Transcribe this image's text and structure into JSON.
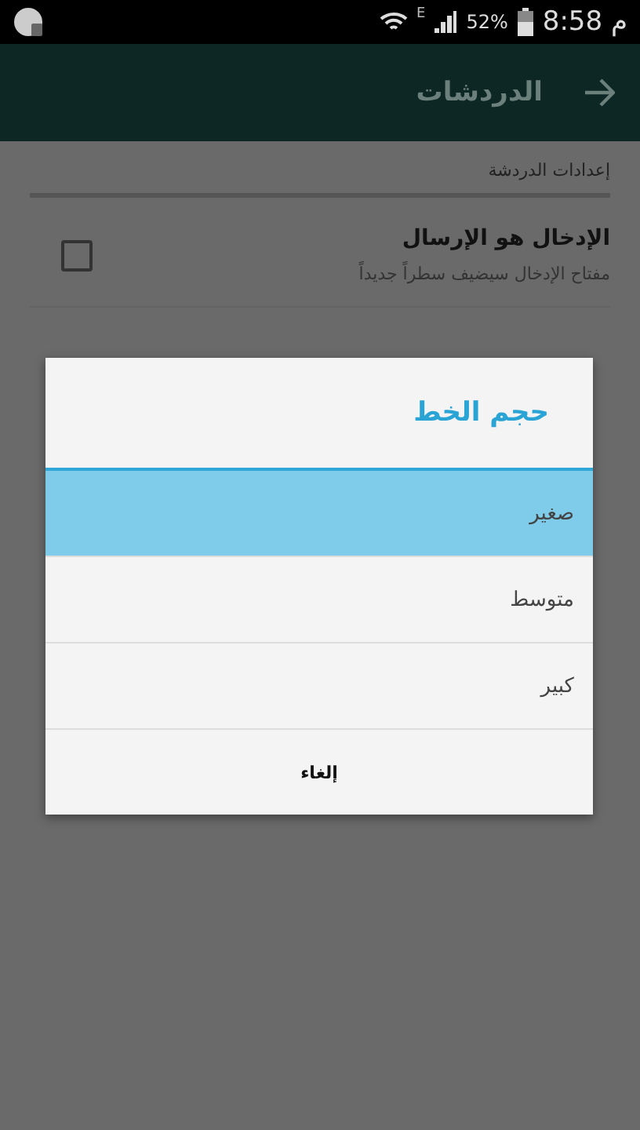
{
  "status_bar": {
    "network": "E",
    "battery": "52%",
    "time": "م 8:58"
  },
  "toolbar": {
    "title": "الدردشات"
  },
  "settings": {
    "section": "إعدادات الدردشة",
    "items": [
      {
        "title": "الإدخال هو الإرسال",
        "subtitle": "مفتاح الإدخال سيضيف سطراً جديداً",
        "checked": false
      }
    ]
  },
  "dialog": {
    "title": "حجم الخط",
    "options": [
      {
        "label": "صغير",
        "selected": true
      },
      {
        "label": "متوسط",
        "selected": false
      },
      {
        "label": "كبير",
        "selected": false
      }
    ],
    "cancel": "إلغاء"
  }
}
